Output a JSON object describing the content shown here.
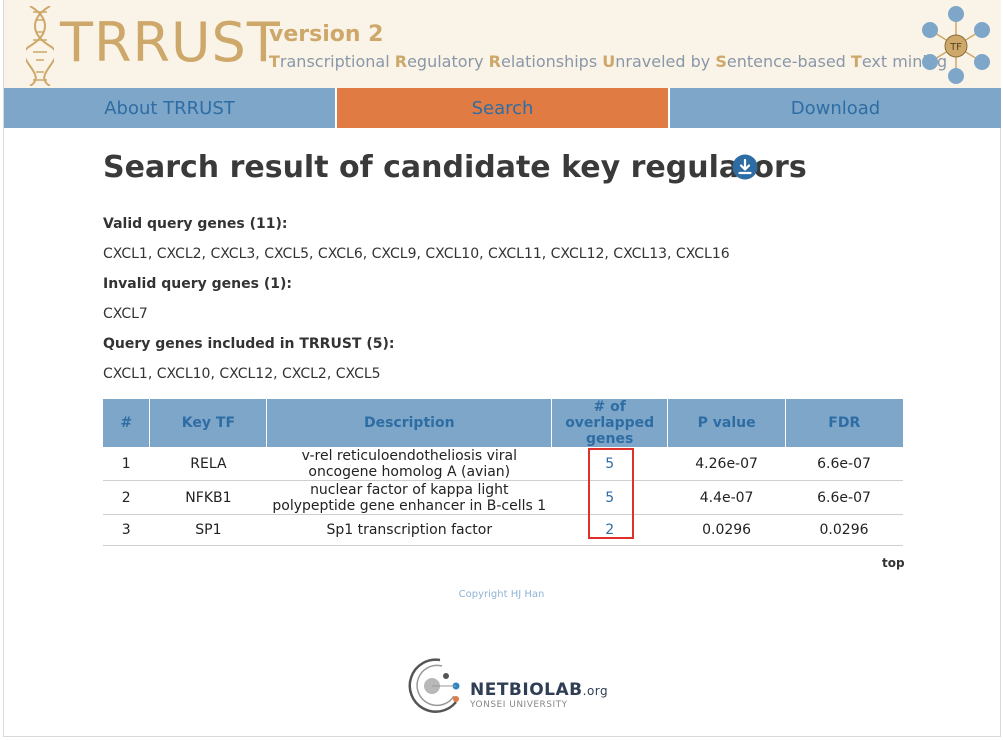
{
  "header": {
    "logo": "TRRUST",
    "version": "version 2",
    "subtitle_parts": [
      {
        "initial": "T",
        "rest": "ranscriptional "
      },
      {
        "initial": "R",
        "rest": "egulatory "
      },
      {
        "initial": "R",
        "rest": "elationships "
      },
      {
        "initial": "U",
        "rest": "nraveled by "
      },
      {
        "initial": "S",
        "rest": "entence-based "
      },
      {
        "initial": "T",
        "rest": "ext mining"
      }
    ],
    "tf_badge": "TF"
  },
  "nav": {
    "about": "About TRRUST",
    "search": "Search",
    "download": "Download"
  },
  "page": {
    "title": "Search result of candidate key regulators",
    "valid_label": "Valid query genes (11):",
    "valid_genes": "CXCL1, CXCL2, CXCL3, CXCL5, CXCL6, CXCL9, CXCL10, CXCL11, CXCL12, CXCL13, CXCL16",
    "invalid_label": "Invalid query genes (1):",
    "invalid_genes": "CXCL7",
    "included_label": "Query genes included in TRRUST (5):",
    "included_genes": "CXCL1, CXCL10, CXCL12, CXCL2, CXCL5"
  },
  "table": {
    "headers": {
      "num": "#",
      "tf": "Key TF",
      "desc": "Description",
      "genes_l1": "# of",
      "genes_l2": "overlapped",
      "genes_l3": "genes",
      "p": "P value",
      "fdr": "FDR"
    },
    "rows": [
      {
        "num": "1",
        "tf": "RELA",
        "desc_l1": "v-rel reticuloendotheliosis viral",
        "desc_l2": "oncogene homolog A (avian)",
        "genes": "5",
        "p": "4.26e-07",
        "fdr": "6.6e-07"
      },
      {
        "num": "2",
        "tf": "NFKB1",
        "desc_l1": "nuclear factor of kappa light",
        "desc_l2": "polypeptide gene enhancer in B-cells 1",
        "genes": "5",
        "p": "4.4e-07",
        "fdr": "6.6e-07"
      },
      {
        "num": "3",
        "tf": "SP1",
        "desc_l1": "Sp1 transcription factor",
        "desc_l2": "",
        "genes": "2",
        "p": "0.0296",
        "fdr": "0.0296"
      }
    ]
  },
  "footer": {
    "top": "top",
    "copyright": "Copyright HJ Han",
    "lab_name": "NETBIOLAB",
    "lab_suffix": ".org",
    "lab_sub": "YONSEI UNIVERSITY"
  },
  "colors": {
    "header_bg": "#faf4e8",
    "gold": "#cda86a",
    "nav_blue": "#7ea6c9",
    "nav_active": "#e07b44",
    "link_blue": "#2e6da4",
    "highlight_red": "#e0302a"
  }
}
